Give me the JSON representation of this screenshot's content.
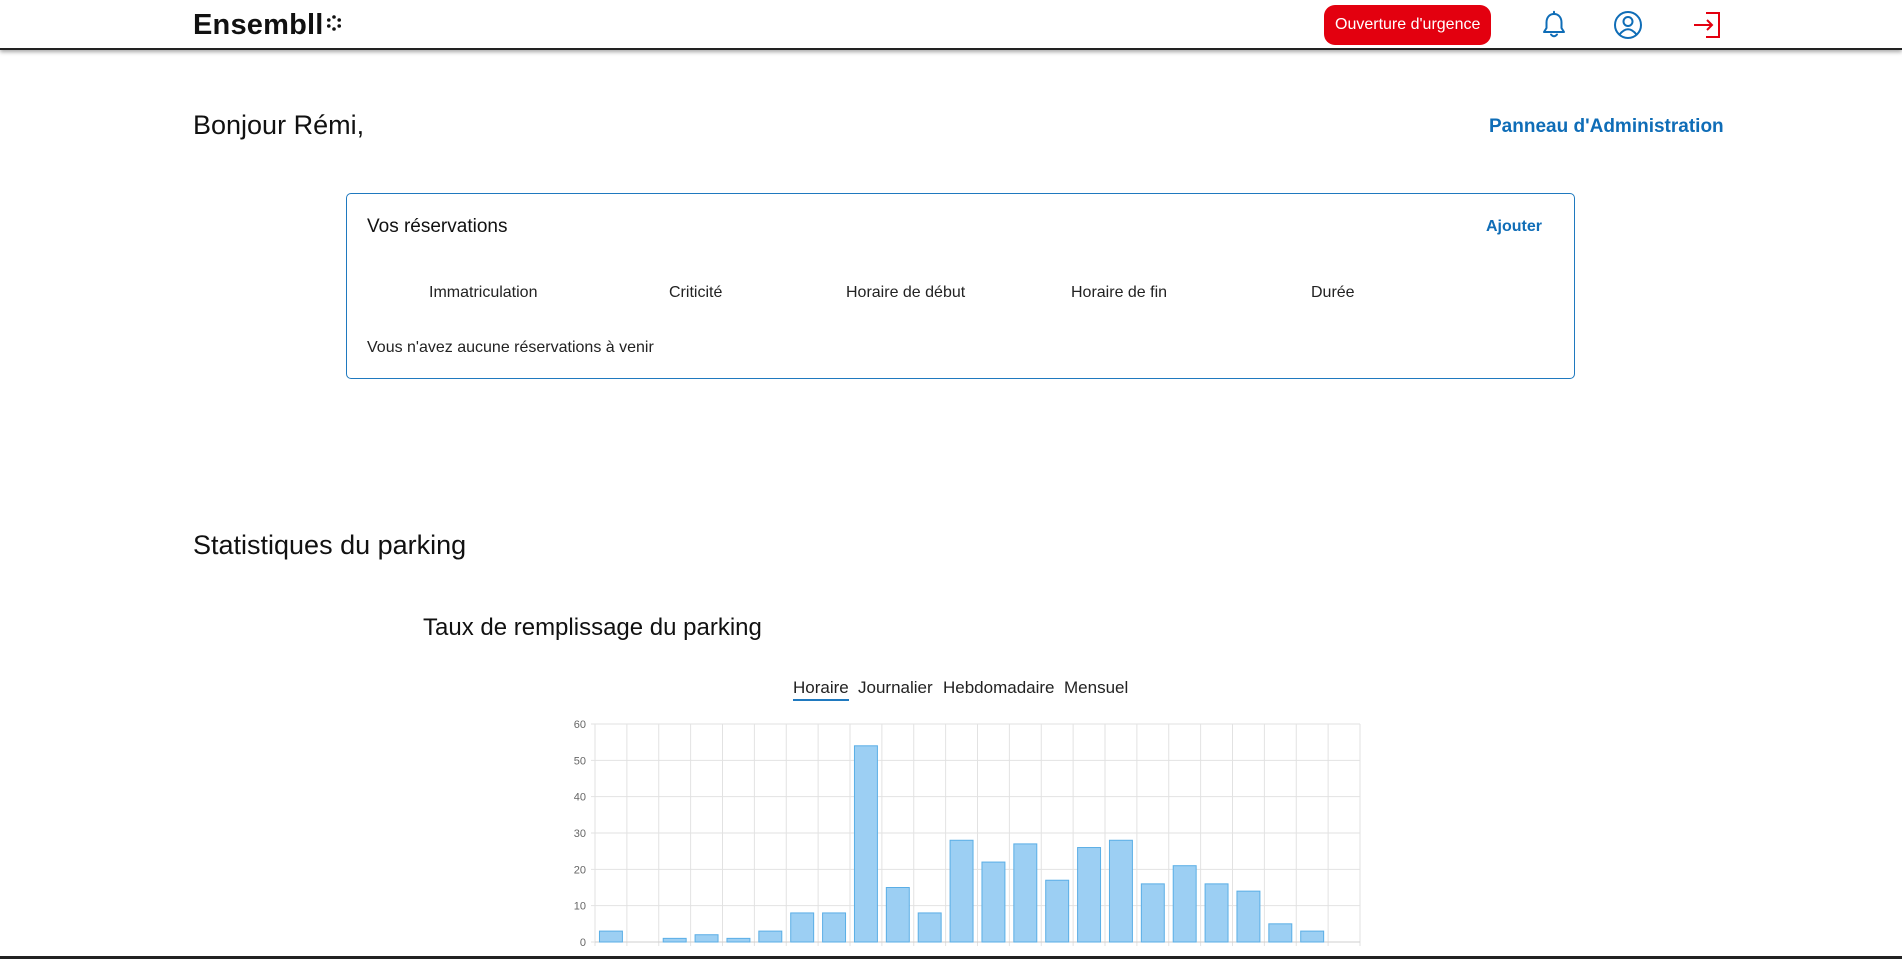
{
  "header": {
    "logo": "Ensembll",
    "urgent_button": "Ouverture d'urgence",
    "icons": [
      "bell-icon",
      "user-circle-icon",
      "logout-icon"
    ]
  },
  "colors": {
    "accent": "#0f6db7",
    "urgent": "#e3000f",
    "bar_fill": "#9ccff3",
    "bar_stroke": "#5aaee6"
  },
  "main": {
    "greeting": "Bonjour Rémi,",
    "admin_link": "Panneau d'Administration"
  },
  "reservations": {
    "title": "Vos réservations",
    "add": "Ajouter",
    "columns": [
      "Immatriculation",
      "Criticité",
      "Horaire de début",
      "Horaire de fin",
      "Durée"
    ],
    "empty": "Vous n'avez aucune réservations à venir"
  },
  "stats": {
    "title": "Statistiques du parking",
    "chart_title": "Taux de remplissage du parking",
    "tabs": [
      "Horaire",
      "Journalier",
      "Hebdomadaire",
      "Mensuel"
    ],
    "active_tab": "Horaire"
  },
  "chart_data": {
    "type": "bar",
    "title": "Taux de remplissage du parking",
    "xlabel": "",
    "ylabel": "",
    "ylim": [
      0,
      60
    ],
    "yticks": [
      0,
      10,
      20,
      30,
      40,
      50,
      60
    ],
    "grid": true,
    "values": [
      3,
      0,
      1,
      2,
      1,
      3,
      8,
      8,
      54,
      15,
      8,
      28,
      22,
      27,
      17,
      26,
      28,
      16,
      21,
      16,
      14,
      5,
      3,
      0
    ]
  }
}
